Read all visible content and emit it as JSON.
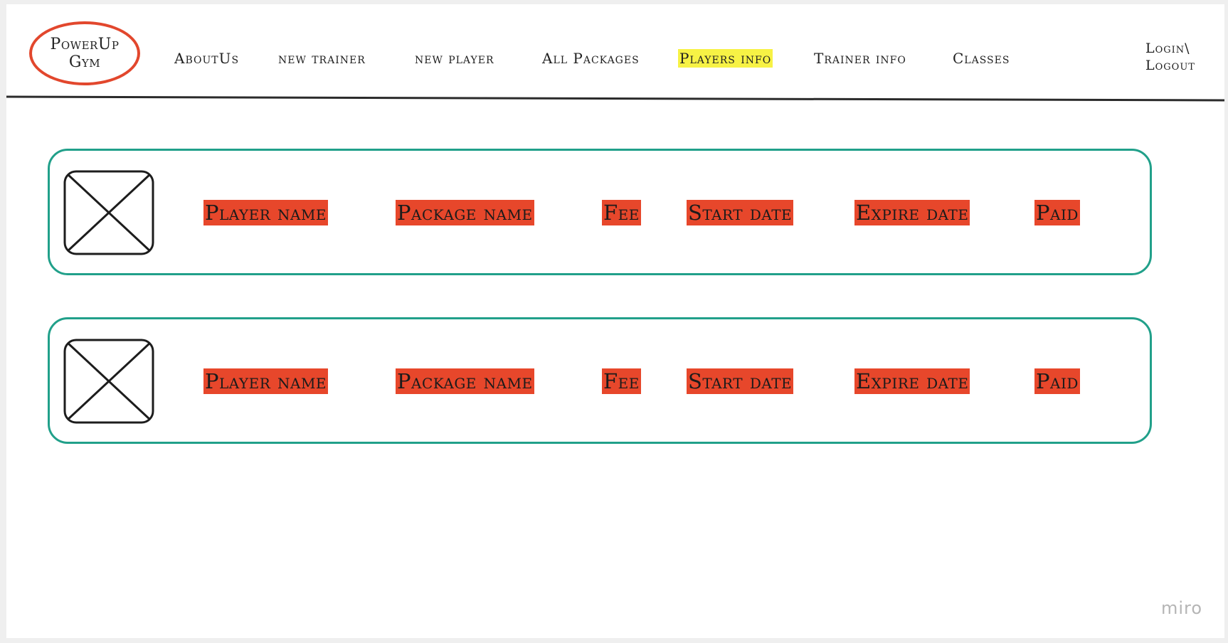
{
  "logo": {
    "line1": "PowerUp",
    "line2": "Gym"
  },
  "nav": {
    "items": [
      {
        "label": "AboutUs",
        "active": false
      },
      {
        "label": "new trainer",
        "active": false
      },
      {
        "label": "new player",
        "active": false
      },
      {
        "label": "All Packages",
        "active": false
      },
      {
        "label": "Players info",
        "active": true
      },
      {
        "label": "Trainer info",
        "active": false
      },
      {
        "label": "Classes",
        "active": false
      }
    ],
    "login_line1": "Login\\",
    "login_line2": "Logout"
  },
  "players": [
    {
      "image_icon": "image-placeholder-icon",
      "player_name": "Player name",
      "package_name": "Package name",
      "fee": "Fee",
      "start_date": "Start date",
      "expire_date": "Expire date",
      "paid": "Paid"
    },
    {
      "image_icon": "image-placeholder-icon",
      "player_name": "Player name",
      "package_name": "Package name",
      "fee": "Fee",
      "start_date": "Start date",
      "expire_date": "Expire date",
      "paid": "Paid"
    }
  ],
  "watermark": "miro",
  "colors": {
    "logo_border": "#e2472d",
    "active_highlight": "#f7f245",
    "card_border": "#21a08a",
    "field_highlight": "#e7472b"
  }
}
